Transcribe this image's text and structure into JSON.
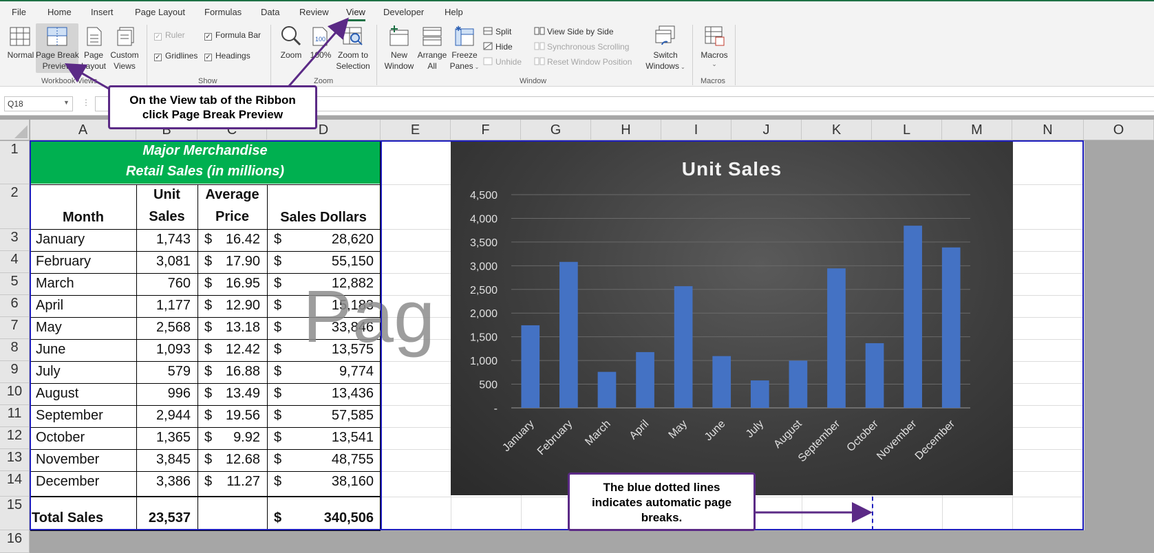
{
  "menu": {
    "items": [
      "File",
      "Home",
      "Insert",
      "Page Layout",
      "Formulas",
      "Data",
      "Review",
      "View",
      "Developer",
      "Help"
    ],
    "active": "View"
  },
  "ribbon": {
    "workbook_views": {
      "group_label": "Workbook Views",
      "normal": "Normal",
      "page_break_preview_l1": "Page Break",
      "page_break_preview_l2": "Preview",
      "page_layout_l1": "Page",
      "page_layout_l2": "Layout",
      "custom_views_l1": "Custom",
      "custom_views_l2": "Views"
    },
    "show": {
      "group_label": "Show",
      "ruler": "Ruler",
      "formula_bar": "Formula Bar",
      "gridlines": "Gridlines",
      "headings": "Headings"
    },
    "zoom": {
      "group_label": "Zoom",
      "zoom": "Zoom",
      "hundred": "100%",
      "zoom_to_selection_l1": "Zoom to",
      "zoom_to_selection_l2": "Selection"
    },
    "window": {
      "group_label": "Window",
      "new_window_l1": "New",
      "new_window_l2": "Window",
      "arrange_all_l1": "Arrange",
      "arrange_all_l2": "All",
      "freeze_panes_l1": "Freeze",
      "freeze_panes_l2": "Panes",
      "split": "Split",
      "hide": "Hide",
      "unhide": "Unhide",
      "view_side_by_side": "View Side by Side",
      "synchronous_scrolling": "Synchronous Scrolling",
      "reset_window_position": "Reset Window Position",
      "switch_windows_l1": "Switch",
      "switch_windows_l2": "Windows"
    },
    "macros": {
      "group_label": "Macros",
      "macros": "Macros"
    }
  },
  "formula_bar": {
    "name_box": "Q18"
  },
  "columns": [
    "A",
    "B",
    "C",
    "D",
    "E",
    "F",
    "G",
    "H",
    "I",
    "J",
    "K",
    "L",
    "M",
    "N",
    "O"
  ],
  "rows": [
    "1",
    "2",
    "3",
    "4",
    "5",
    "6",
    "7",
    "8",
    "9",
    "10",
    "11",
    "12",
    "13",
    "14",
    "15",
    "16"
  ],
  "table": {
    "title_l1": "Major Merchandise",
    "title_l2": "Retail Sales (in millions)",
    "header": {
      "month": "Month",
      "unit_l1": "Unit",
      "unit_l2": "Sales",
      "avg_l1": "Average",
      "avg_l2": "Price",
      "sales": "Sales Dollars"
    },
    "currency": "$",
    "data": [
      {
        "month": "January",
        "units": "1,743",
        "price": "16.42",
        "dollars": "28,620"
      },
      {
        "month": "February",
        "units": "3,081",
        "price": "17.90",
        "dollars": "55,150"
      },
      {
        "month": "March",
        "units": "760",
        "price": "16.95",
        "dollars": "12,882"
      },
      {
        "month": "April",
        "units": "1,177",
        "price": "12.90",
        "dollars": "15,183"
      },
      {
        "month": "May",
        "units": "2,568",
        "price": "13.18",
        "dollars": "33,846"
      },
      {
        "month": "June",
        "units": "1,093",
        "price": "12.42",
        "dollars": "13,575"
      },
      {
        "month": "July",
        "units": "579",
        "price": "16.88",
        "dollars": "9,774"
      },
      {
        "month": "August",
        "units": "996",
        "price": "13.49",
        "dollars": "13,436"
      },
      {
        "month": "September",
        "units": "2,944",
        "price": "19.56",
        "dollars": "57,585"
      },
      {
        "month": "October",
        "units": "1,365",
        "price": "9.92",
        "dollars": "13,541"
      },
      {
        "month": "November",
        "units": "3,845",
        "price": "12.68",
        "dollars": "48,755"
      },
      {
        "month": "December",
        "units": "3,386",
        "price": "11.27",
        "dollars": "38,160"
      }
    ],
    "total_label": "Total Sales",
    "total_units": "23,537",
    "total_dollars": "340,506"
  },
  "watermark": "Pag",
  "chart_data": {
    "type": "bar",
    "title": "Unit Sales",
    "categories": [
      "January",
      "February",
      "March",
      "April",
      "May",
      "June",
      "July",
      "August",
      "September",
      "October",
      "November",
      "December"
    ],
    "values": [
      1743,
      3081,
      760,
      1177,
      2568,
      1093,
      579,
      996,
      2944,
      1365,
      3845,
      3386
    ],
    "ylim": [
      0,
      4500
    ],
    "yticks": [
      "-",
      "500",
      "1,000",
      "1,500",
      "2,000",
      "2,500",
      "3,000",
      "3,500",
      "4,000",
      "4,500"
    ],
    "grid": true,
    "bar_color": "#4472c4"
  },
  "callouts": {
    "ribbon_l1": "On the View tab of the Ribbon",
    "ribbon_l2": "click Page Break Preview",
    "breaks_l1": "The blue dotted lines",
    "breaks_l2": "indicates automatic page",
    "breaks_l3": "breaks."
  },
  "colors": {
    "title_fill": "#00b050",
    "callout_border": "#5b2a86",
    "page_break": "#1f1fbf",
    "excel_green": "#1e7145"
  }
}
